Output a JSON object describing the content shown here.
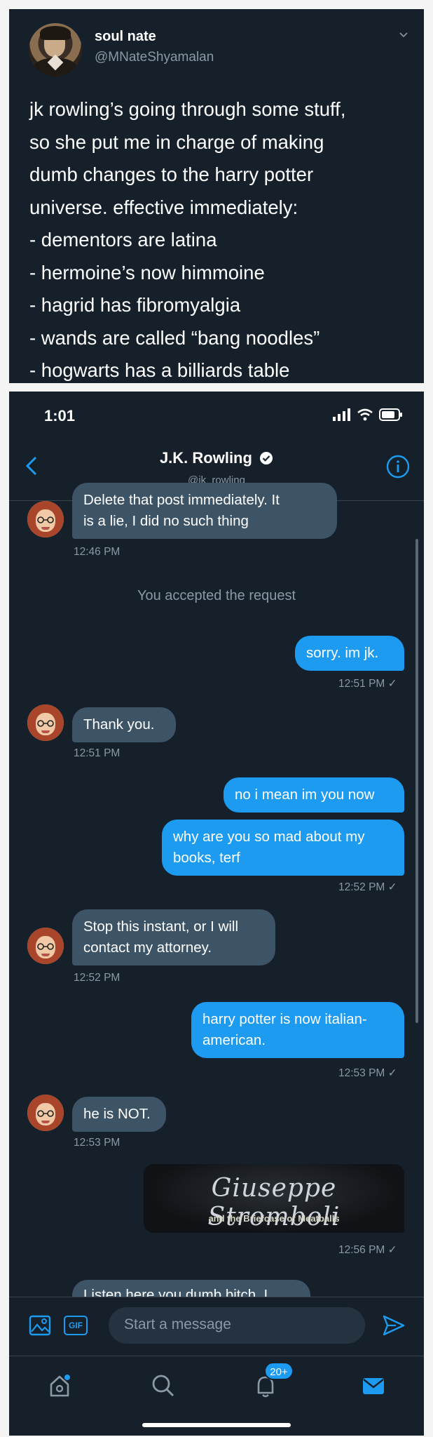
{
  "tweet": {
    "name": "soul nate",
    "handle": "@MNateShyamalan",
    "lines": [
      "jk rowling’s going through some stuff,",
      "so she put me in charge of making",
      "dumb changes to the harry potter",
      "universe. effective immediately:",
      "- dementors are latina",
      "- hermoine’s now himmoine",
      "- hagrid has fibromyalgia",
      "- wands are called “bang noodles”",
      "- hogwarts has a billiards table"
    ]
  },
  "dm": {
    "status_time": "1:01",
    "contact_name": "J.K. Rowling",
    "contact_handle": "@jk_rowling",
    "messages": [
      {
        "dir": "in",
        "lines": [
          "Delete that post immediately. It",
          "is a lie, I did no such thing"
        ],
        "time": "12:46 PM"
      },
      {
        "system": "You accepted the request"
      },
      {
        "dir": "out",
        "lines": [
          "sorry. im jk."
        ],
        "time": "12:51 PM ✓"
      },
      {
        "dir": "in",
        "lines": [
          "Thank you."
        ],
        "time": "12:51 PM"
      },
      {
        "dir": "out",
        "lines": [
          "no i mean im you now"
        ]
      },
      {
        "dir": "out",
        "lines": [
          "why are you so mad about my",
          "books, terf"
        ],
        "time": "12:52 PM ✓"
      },
      {
        "dir": "in",
        "lines": [
          "Stop this instant, or I will",
          "contact my attorney."
        ],
        "time": "12:52 PM"
      },
      {
        "dir": "out",
        "lines": [
          "harry potter is now italian-",
          "american."
        ],
        "time": "12:53 PM ✓"
      },
      {
        "dir": "in",
        "lines": [
          "he is NOT."
        ],
        "time": "12:53 PM"
      },
      {
        "dir": "out",
        "image_title": "Giuseppe Stromboli",
        "image_subtitle": "and the Briefcase of Meatballs",
        "time": "12:56 PM ✓"
      },
      {
        "dir": "in",
        "lines": [
          "Listen here you dumb bitch. I"
        ]
      }
    ],
    "composer_placeholder": "Start a message",
    "gif_label": "GIF",
    "notification_badge": "20+"
  },
  "colors": {
    "background": "#15202b",
    "accent": "#1d9bf0",
    "incoming_bubble": "#3d5466",
    "muted_text": "#8b98a5"
  }
}
